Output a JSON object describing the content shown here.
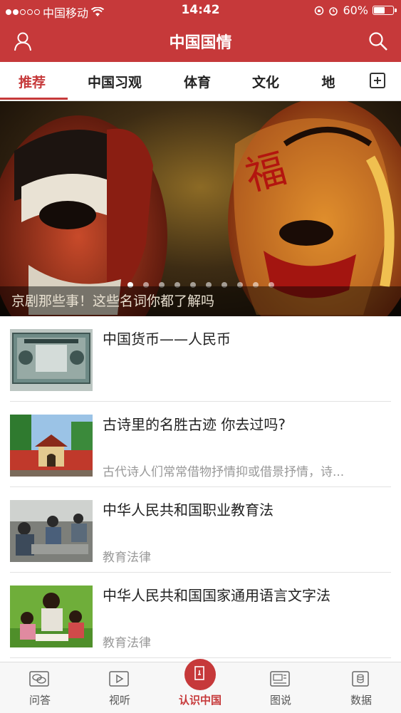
{
  "status_bar": {
    "carrier": "中国移动",
    "time": "14:42",
    "battery": "60%",
    "battery_level": 0.6
  },
  "header": {
    "title": "中国国情"
  },
  "tabs": [
    {
      "label": "推荐",
      "active": true
    },
    {
      "label": "中国习观",
      "active": false
    },
    {
      "label": "体育",
      "active": false
    },
    {
      "label": "文化",
      "active": false
    },
    {
      "label": "地",
      "active": false
    }
  ],
  "banner": {
    "caption": "京剧那些事！这些名词你都了解吗",
    "page_count": 10,
    "current_page": 1
  },
  "articles": [
    {
      "title": "中国货币——人民币",
      "subtitle": ""
    },
    {
      "title": "古诗里的名胜古迹 你去过吗?",
      "subtitle": "古代诗人们常常借物抒情抑或借景抒情，诗..."
    },
    {
      "title": "中华人民共和国职业教育法",
      "subtitle": "教育法律"
    },
    {
      "title": "中华人民共和国国家通用语言文字法",
      "subtitle": "教育法律"
    }
  ],
  "bottom_nav": [
    {
      "label": "问答",
      "icon": "chat-bubbles-icon",
      "active": false
    },
    {
      "label": "视听",
      "icon": "play-icon",
      "active": false
    },
    {
      "label": "认识中国",
      "icon": "door-icon",
      "active": true
    },
    {
      "label": "图说",
      "icon": "picture-icon",
      "active": false
    },
    {
      "label": "数据",
      "icon": "database-icon",
      "active": false
    }
  ],
  "colors": {
    "brand_red": "#c6393a"
  }
}
